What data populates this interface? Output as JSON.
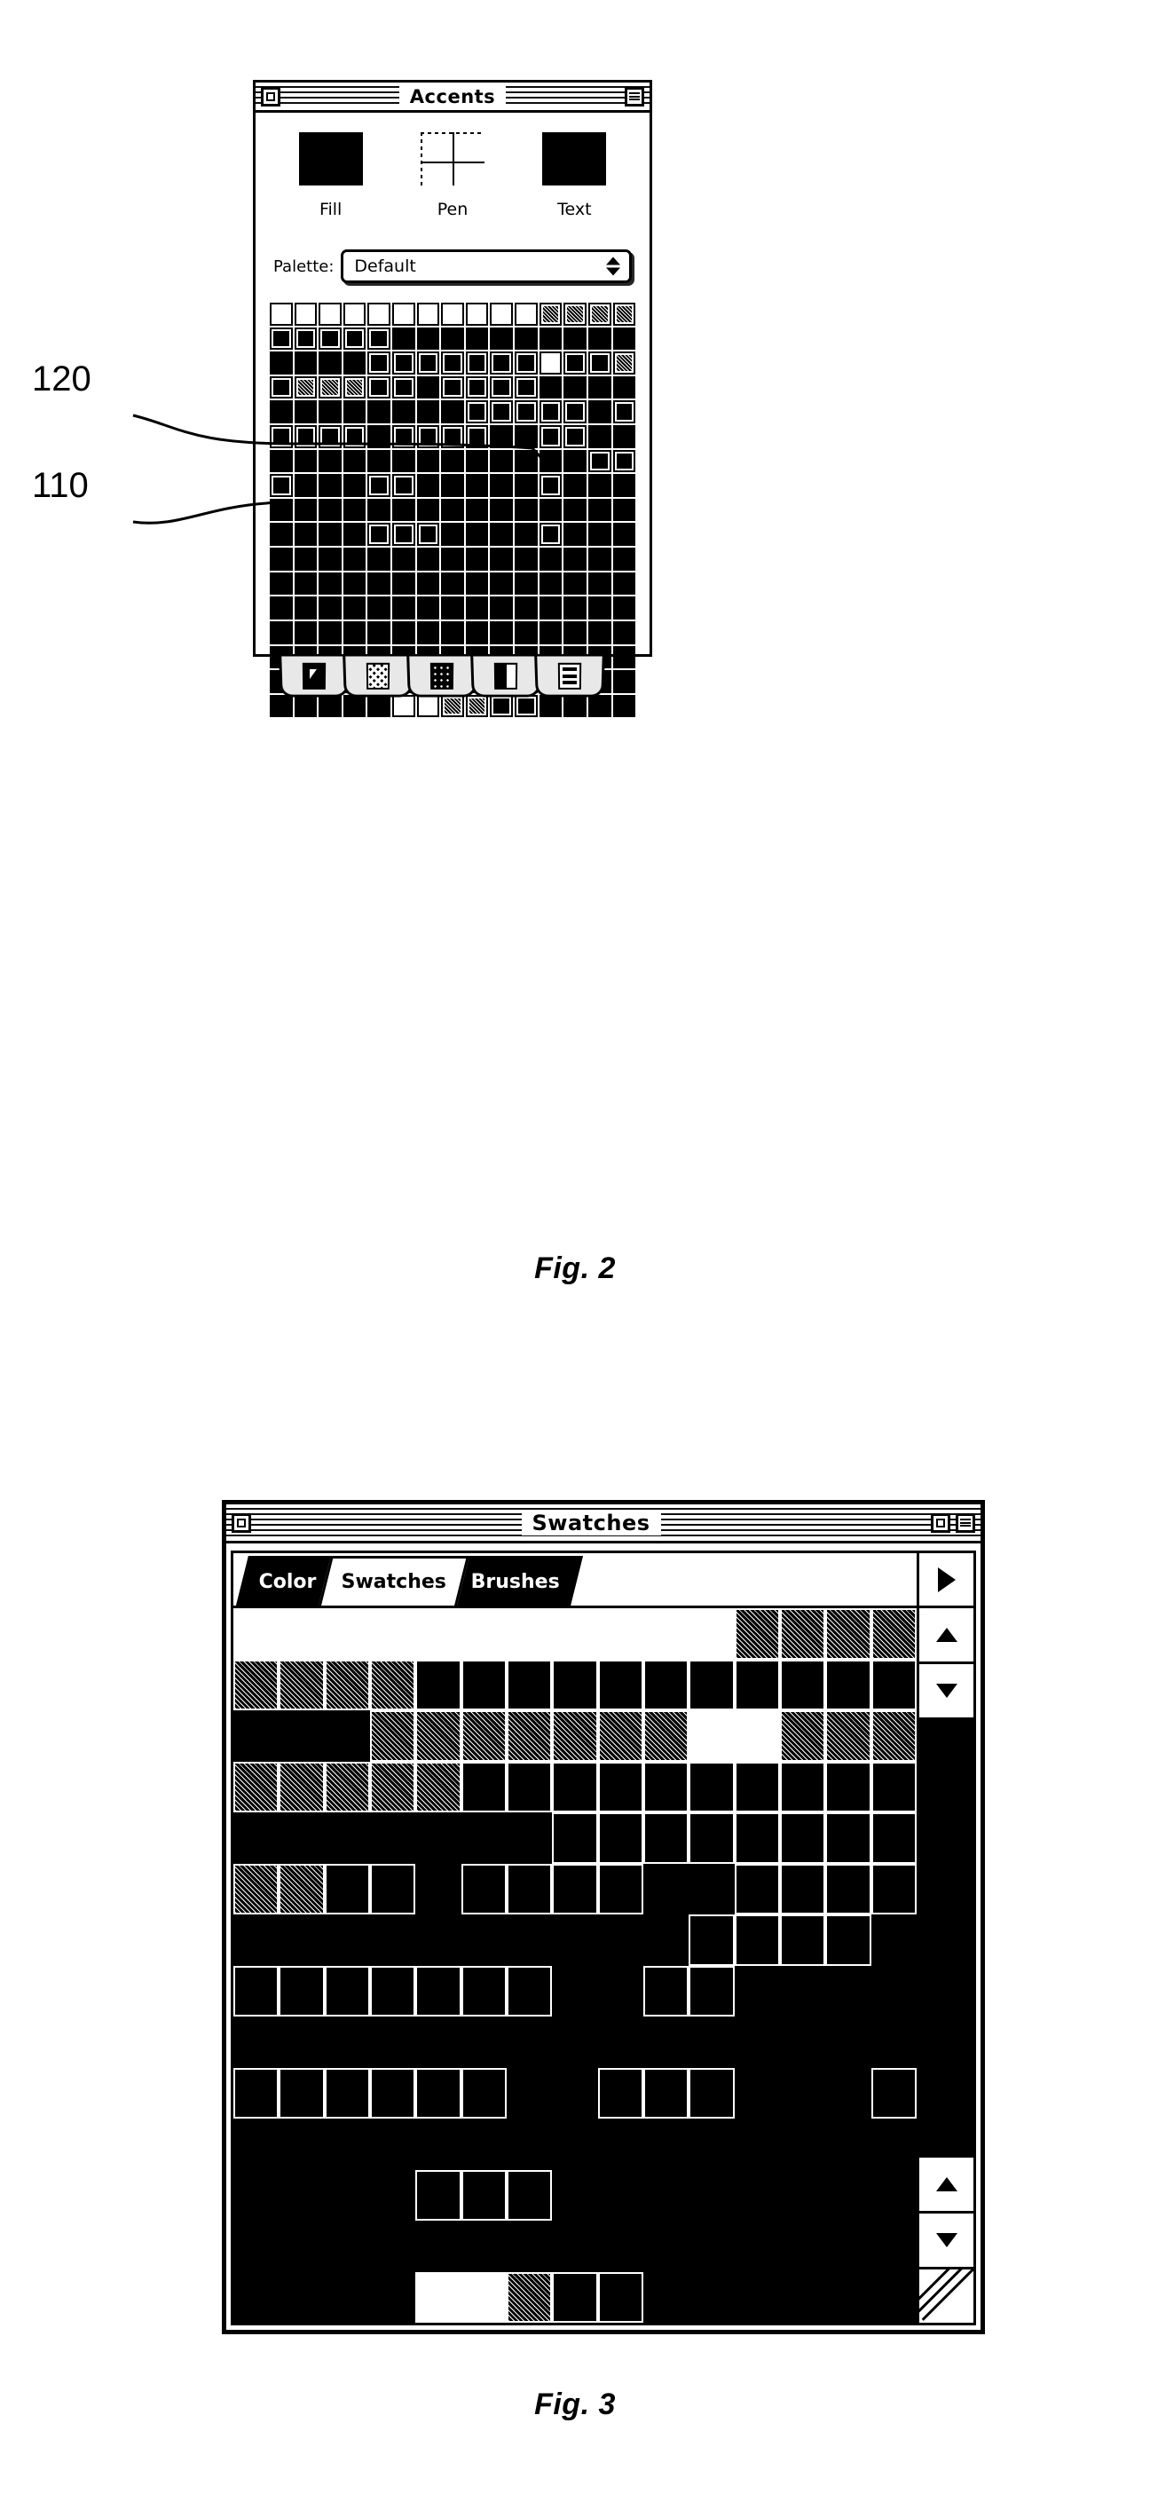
{
  "document": {
    "type": "patent-drawing",
    "figures": [
      {
        "id": "fig2",
        "caption": "Fig. 2"
      },
      {
        "id": "fig3",
        "caption": "Fig. 3"
      }
    ]
  },
  "reference_numerals": [
    {
      "label": "120",
      "points_to": "palette-swatch-cell"
    },
    {
      "label": "110",
      "points_to": "palette-swatch-row"
    }
  ],
  "fig2": {
    "window": {
      "title": "Accents",
      "close_button": "close-box",
      "menu_button": "window-menu"
    },
    "accent_controls": [
      {
        "name": "Fill",
        "swatch": "solid-black"
      },
      {
        "name": "Pen",
        "swatch": "crosshair-none"
      },
      {
        "name": "Text",
        "swatch": "solid-black"
      }
    ],
    "palette": {
      "label": "Palette:",
      "selected": "Default",
      "options": [
        "Default"
      ]
    },
    "swatch_grid": {
      "columns": 15,
      "rows": 17,
      "cells": [
        [
          "blank",
          "blank",
          "blank",
          "blank",
          "blank",
          "blank",
          "blank",
          "blank",
          "blank",
          "blank",
          "blank",
          "tex",
          "tex",
          "tex",
          "tex"
        ],
        [
          "ring",
          "ring",
          "ring",
          "ring",
          "ring",
          "fill",
          "fill",
          "fill",
          "fill",
          "fill",
          "fill",
          "fill",
          "fill",
          "fill",
          "fill"
        ],
        [
          "fill",
          "fill",
          "fill",
          "fill",
          "ring",
          "ring",
          "ring",
          "ring",
          "ring",
          "ring",
          "ring",
          "blank",
          "ring",
          "ring",
          "tex"
        ],
        [
          "ring",
          "tex",
          "tex",
          "tex",
          "ring",
          "ring",
          "fill",
          "ring",
          "ring",
          "ring",
          "ring",
          "fill",
          "fill",
          "fill",
          "fill"
        ],
        [
          "fill",
          "fill",
          "fill",
          "fill",
          "fill",
          "fill",
          "fill",
          "fill",
          "ring",
          "ring",
          "ring",
          "ring",
          "ring",
          "fill",
          "ring"
        ],
        [
          "ring",
          "ring",
          "ring",
          "ring",
          "fill",
          "ring",
          "ring",
          "ring",
          "ring",
          "fill",
          "fill",
          "ring",
          "ring",
          "fill",
          "fill"
        ],
        [
          "fill",
          "fill",
          "fill",
          "fill",
          "fill",
          "fill",
          "fill",
          "fill",
          "fill",
          "fill",
          "fill",
          "fill",
          "fill",
          "ring",
          "ring"
        ],
        [
          "ring",
          "fill",
          "fill",
          "fill",
          "ring",
          "ring",
          "fill",
          "fill",
          "fill",
          "fill",
          "fill",
          "ring",
          "fill",
          "fill",
          "fill"
        ],
        [
          "fill",
          "fill",
          "fill",
          "fill",
          "fill",
          "fill",
          "fill",
          "fill",
          "fill",
          "fill",
          "fill",
          "fill",
          "fill",
          "fill",
          "fill"
        ],
        [
          "fill",
          "fill",
          "fill",
          "fill",
          "ring",
          "ring",
          "ring",
          "fill",
          "fill",
          "fill",
          "fill",
          "ring",
          "fill",
          "fill",
          "fill"
        ],
        [
          "fill",
          "fill",
          "fill",
          "fill",
          "fill",
          "fill",
          "fill",
          "fill",
          "fill",
          "fill",
          "fill",
          "fill",
          "fill",
          "fill",
          "fill"
        ],
        [
          "fill",
          "fill",
          "fill",
          "fill",
          "fill",
          "fill",
          "fill",
          "fill",
          "fill",
          "fill",
          "fill",
          "fill",
          "fill",
          "fill",
          "fill"
        ],
        [
          "fill",
          "fill",
          "fill",
          "fill",
          "fill",
          "fill",
          "fill",
          "fill",
          "fill",
          "fill",
          "fill",
          "fill",
          "fill",
          "fill",
          "fill"
        ],
        [
          "fill",
          "fill",
          "fill",
          "fill",
          "fill",
          "fill",
          "fill",
          "fill",
          "fill",
          "fill",
          "fill",
          "fill",
          "fill",
          "fill",
          "fill"
        ],
        [
          "fill",
          "fill",
          "fill",
          "fill",
          "fill",
          "fill",
          "fill",
          "fill",
          "fill",
          "fill",
          "fill",
          "fill",
          "fill",
          "fill",
          "fill"
        ],
        [
          "fill",
          "fill",
          "fill",
          "fill",
          "fill",
          "fill",
          "fill",
          "fill",
          "fill",
          "fill",
          "fill",
          "fill",
          "fill",
          "fill",
          "fill"
        ],
        [
          "fill",
          "fill",
          "fill",
          "fill",
          "fill",
          "blank",
          "blank",
          "tex",
          "tex",
          "ring",
          "ring",
          "fill",
          "fill",
          "fill",
          "fill"
        ]
      ]
    },
    "tabs": [
      {
        "icon": "arrow-cursor-icon"
      },
      {
        "icon": "checker-pattern-icon"
      },
      {
        "icon": "dot-pattern-icon"
      },
      {
        "icon": "gradient-icon"
      },
      {
        "icon": "lines-list-icon"
      }
    ]
  },
  "fig3": {
    "window": {
      "title": "Swatches",
      "close_button": "close-box",
      "zoom_button": "zoom-box",
      "menu_button": "window-menu"
    },
    "tabs": [
      {
        "label": "Color",
        "active": false
      },
      {
        "label": "Swatches",
        "active": true
      },
      {
        "label": "Brushes",
        "active": false
      }
    ],
    "tab_overflow_icon": "triangle-right-icon",
    "scrollbar": {
      "up_icon": "triangle-up-icon",
      "down_icon": "triangle-down-icon",
      "resize_grip": "resize-grip-icon"
    },
    "swatch_grid": {
      "columns": 15,
      "rows": 14,
      "cells": [
        [
          "w",
          "w",
          "w",
          "w",
          "w",
          "w",
          "w",
          "w",
          "w",
          "w",
          "w",
          "g",
          "g",
          "g",
          "g"
        ],
        [
          "g",
          "g",
          "g",
          "g",
          "open",
          "open",
          "open",
          "open",
          "open",
          "open",
          "open",
          "open",
          "open",
          "open",
          "open"
        ],
        [
          "none",
          "none",
          "none",
          "g",
          "g",
          "g",
          "g",
          "g",
          "g",
          "g",
          "w",
          "w",
          "g",
          "g",
          "g"
        ],
        [
          "g",
          "g",
          "g",
          "g",
          "g",
          "open",
          "open",
          "open",
          "open",
          "open",
          "open",
          "open",
          "open",
          "open",
          "open"
        ],
        [
          "none",
          "none",
          "none",
          "none",
          "none",
          "none",
          "none",
          "open",
          "open",
          "open",
          "open",
          "open",
          "open",
          "open",
          "open"
        ],
        [
          "g",
          "g",
          "open",
          "open",
          "none",
          "open",
          "open",
          "open",
          "open",
          "none",
          "none",
          "open",
          "open",
          "open",
          "open"
        ],
        [
          "none",
          "none",
          "none",
          "none",
          "none",
          "none",
          "none",
          "none",
          "none",
          "none",
          "open",
          "open",
          "open",
          "open",
          "none"
        ],
        [
          "open",
          "open",
          "open",
          "open",
          "open",
          "open",
          "open",
          "none",
          "none",
          "open",
          "open",
          "none",
          "none",
          "none",
          "none"
        ],
        [
          "none",
          "none",
          "none",
          "none",
          "none",
          "none",
          "none",
          "none",
          "none",
          "none",
          "none",
          "none",
          "none",
          "none",
          "none"
        ],
        [
          "open",
          "open",
          "open",
          "open",
          "open",
          "open",
          "none",
          "none",
          "open",
          "open",
          "open",
          "none",
          "none",
          "none",
          "open"
        ],
        [
          "none",
          "none",
          "none",
          "none",
          "none",
          "none",
          "none",
          "none",
          "none",
          "none",
          "none",
          "none",
          "none",
          "none",
          "none"
        ],
        [
          "none",
          "none",
          "none",
          "none",
          "open",
          "open",
          "open",
          "none",
          "none",
          "none",
          "none",
          "none",
          "none",
          "none",
          "none"
        ],
        [
          "none",
          "none",
          "none",
          "none",
          "none",
          "none",
          "none",
          "none",
          "none",
          "none",
          "none",
          "none",
          "none",
          "none",
          "none"
        ],
        [
          "none",
          "none",
          "none",
          "none",
          "w",
          "w",
          "g",
          "open",
          "open",
          "none",
          "none",
          "none",
          "none",
          "none",
          "none"
        ]
      ]
    }
  }
}
